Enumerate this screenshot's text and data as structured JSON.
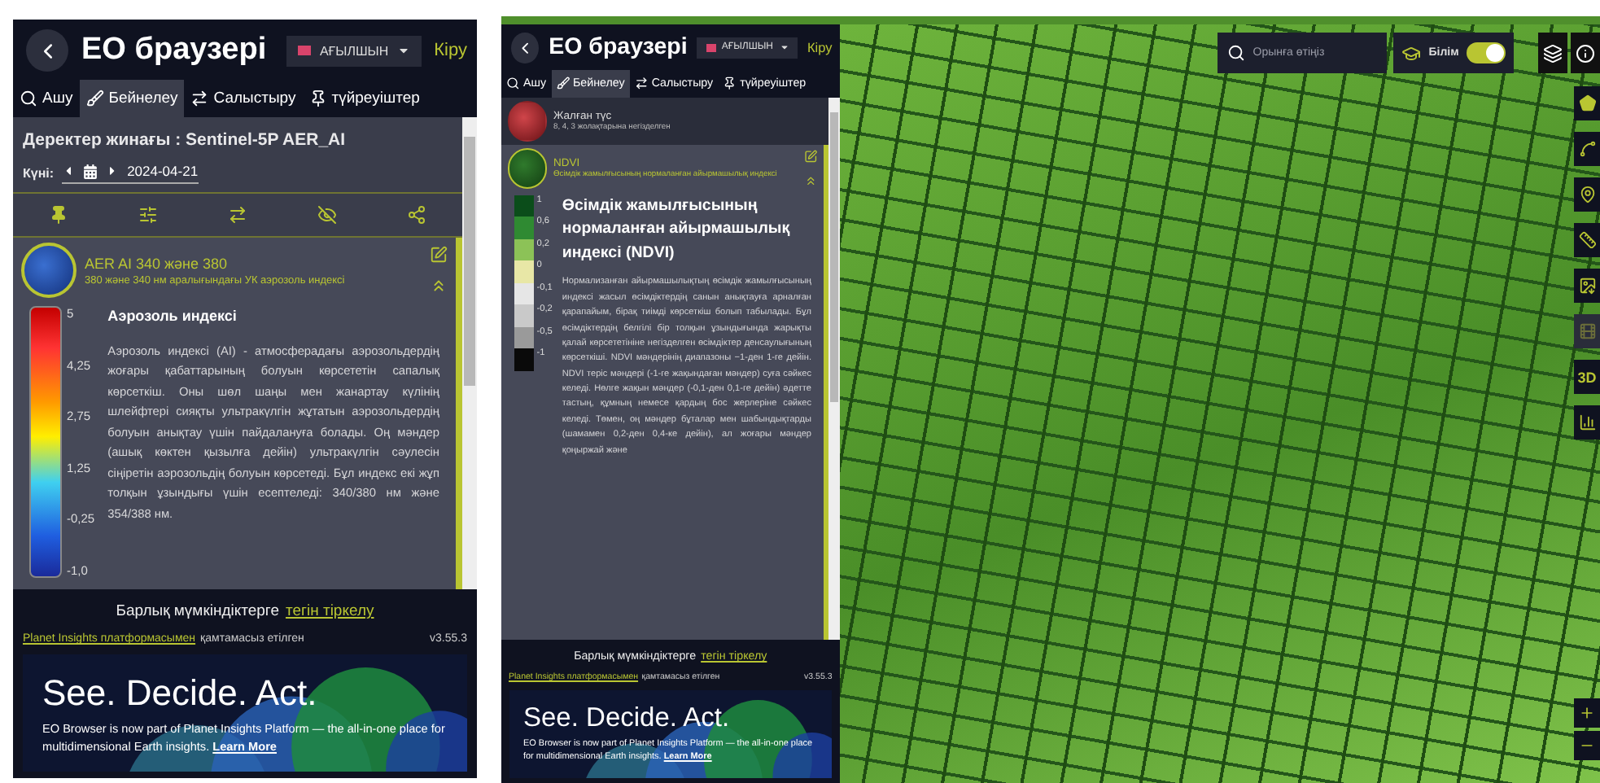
{
  "screens": [
    {
      "header": {
        "title": "EO браузері",
        "language": "АҒЫЛШЫН",
        "login": "Кіру"
      },
      "tabs": [
        {
          "kind": "search",
          "label": "Ашу",
          "selected": false
        },
        {
          "kind": "brush",
          "label": "Бейнелеу",
          "selected": true
        },
        {
          "kind": "compare",
          "label": "Салыстыру",
          "selected": false
        },
        {
          "kind": "pin",
          "label": "түйреуіштер",
          "selected": false
        }
      ],
      "dataset": "Деректер жинағы : Sentinel-5P AER_AI",
      "date": {
        "label": "Күні:",
        "value": "2024-04-21"
      },
      "toolbar": true,
      "layers": [
        {
          "kind": "aerosol",
          "title": "AER AI 340 және 380",
          "subtitle": "380 және 340 нм аралығындағы УК аэрозоль индексі",
          "selected": true,
          "legend": {
            "kind": "gradient",
            "title": "Аэрозоль индексі",
            "ticks": [
              "5",
              "4,25",
              "2,75",
              "1,25",
              "-0,25",
              "-1,0"
            ],
            "description": "Аэрозоль индексі (AI) - атмосферадағы аэрозольдердің жоғары қабаттарының болуын көрсететін сапалық көрсеткіш. Оны шөл шаңы мен жанартау күлінің шлейфтері сияқты ультракүлгін жұтатын аэрозольдердің болуын анықтау үшін пайдалануға болады. Оң мәндер (ашық көктен қызылға дейін) ультракүлгін сәулесін сіңіретін аэрозольдің болуын көрсетеді. Бұл индекс екі жұп толқын ұзындығы үшін есептеледі: 340/380 нм және 354/388 нм."
          }
        }
      ],
      "footer": {
        "signup_text": "Барлық мүмкіндіктерге",
        "signup_link": "тегін тіркелу",
        "powered_link": "Planet Insights платформасымен",
        "powered_text": "қамтамасыз етілген",
        "version": "v3.55.3"
      },
      "banner": {
        "headline": "See. Decide. Act.",
        "body": "EO Browser is now part of Planet Insights Platform — the all-in-one place for multidimensional Earth insights.",
        "link": "Learn More"
      }
    },
    {
      "header": {
        "title": "EO браузері",
        "language": "АҒЫЛШЫН",
        "login": "Кіру"
      },
      "tabs": [
        {
          "kind": "search",
          "label": "Ашу",
          "selected": false
        },
        {
          "kind": "brush",
          "label": "Бейнелеу",
          "selected": true
        },
        {
          "kind": "compare",
          "label": "Салыстыру",
          "selected": false
        },
        {
          "kind": "pin",
          "label": "түйреуіштер",
          "selected": false
        }
      ],
      "layers": [
        {
          "kind": "falsecolor",
          "title": "Жалған түс",
          "subtitle": "8, 4, 3 жолақтарына негізделген",
          "selected": false
        },
        {
          "kind": "vegetation",
          "title": "NDVI",
          "subtitle": "Өсімдік жамылғысының нормаланған айырмашылық индексі",
          "selected": true,
          "legend": {
            "kind": "steps",
            "title": "Өсімдік жамылғысының нормаланған айырмашылық индексі (NDVI)",
            "entries": [
              {
                "label": "1",
                "color": "#0b4d1a"
              },
              {
                "label": "0,6",
                "color": "#2f8a32"
              },
              {
                "label": "0,2",
                "color": "#8cc257"
              },
              {
                "label": "0",
                "color": "#e8e7a6"
              },
              {
                "label": "-0,1",
                "color": "#e6e6e6"
              },
              {
                "label": "-0,2",
                "color": "#c9c9c9"
              },
              {
                "label": "-0,5",
                "color": "#9a9a9a"
              },
              {
                "label": "-1",
                "color": "#0a0a0a"
              }
            ],
            "description": "Нормализанған айырмашылықтың өсімдік жамылғысының индексі жасыл өсімдіктердің санын анықтауға арналған қарапайым, бірақ тиімді көрсеткіш болып табылады. Бұл өсімдіктердің белгілі бір толқын ұзындығында жарықты қалай көрсететініне негізделген өсімдіктер денсаулығының көрсеткіші. NDVI мәндерінің диапазоны −1-ден 1-ге дейін. NDVI теріс мәндері (-1-ге жақындаған мәндер) суға сәйкес келеді. Нөлге жақын мәндер (-0,1-ден 0,1-ге дейін) әдетте тастың, құмның немесе қардың бос жерлеріне сәйкес келеді. Төмен, оң мәндер бұталар мен шабындықтарды (шамамен 0,2-ден 0,4-ке дейін), ал жоғары мәндер қоңыржай және"
          }
        }
      ],
      "footer": {
        "signup_text": "Барлық мүмкіндіктерге",
        "signup_link": "тегін тіркелу",
        "powered_link": "Planet Insights платформасымен",
        "powered_text": "қамтамасыз етілген",
        "version": "v3.55.3"
      },
      "banner": {
        "headline": "See. Decide. Act.",
        "body": "EO Browser is now part of Planet Insights Platform — the all-in-one place for multidimensional Earth insights.",
        "link": "Learn More"
      },
      "map": {
        "search": {
          "placeholder": "Орынға өтіңіз"
        },
        "education": {
          "label": "Білім",
          "on": true
        },
        "tools": [
          {
            "kind": "polygon",
            "disabled": false
          },
          {
            "kind": "line",
            "disabled": false
          },
          {
            "kind": "pin",
            "disabled": false
          },
          {
            "kind": "ruler",
            "disabled": false
          },
          {
            "kind": "image",
            "disabled": false
          },
          {
            "kind": "film",
            "disabled": true
          },
          {
            "kind": "terrain",
            "label": "3D",
            "disabled": false
          },
          {
            "kind": "chart",
            "disabled": false
          }
        ]
      }
    }
  ]
}
